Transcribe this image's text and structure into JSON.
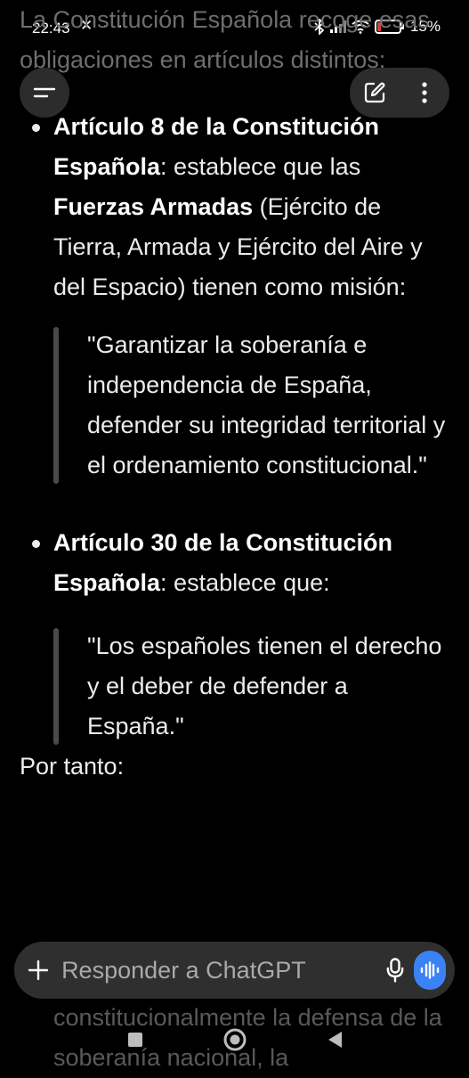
{
  "status_bar": {
    "time": "22:43",
    "left_icons": "✕ ···",
    "battery_percent": "15%",
    "battery_color": "#e53935"
  },
  "article": {
    "intro_ghost": "La Constitución Española recoge esas obligaciones en artículos distintos:",
    "items": [
      {
        "bold_title": "Artículo 8 de la Constitución Española",
        "text_1": ": establece que las ",
        "bold_term": "Fuerzas Armadas",
        "text_2": " (Ejército de Tierra, Armada y Ejército del Aire y del Espacio) tienen como misión:",
        "quote": "\"Garantizar la soberanía e independencia de España, defender su integridad territorial y el ordenamiento constitucional.\""
      },
      {
        "bold_title": "Artículo 30 de la Constitución Española",
        "text_1": ": establece que:",
        "quote": "\"Los españoles tienen el derecho y el deber de defender a España.\""
      }
    ],
    "conclusion": "Por tanto:",
    "trailing_ghost": "constitucionalmente la defensa de la soberanía nacional, la"
  },
  "composer": {
    "placeholder": "Responder a ChatGPT",
    "accent_color": "#3b82f6"
  }
}
